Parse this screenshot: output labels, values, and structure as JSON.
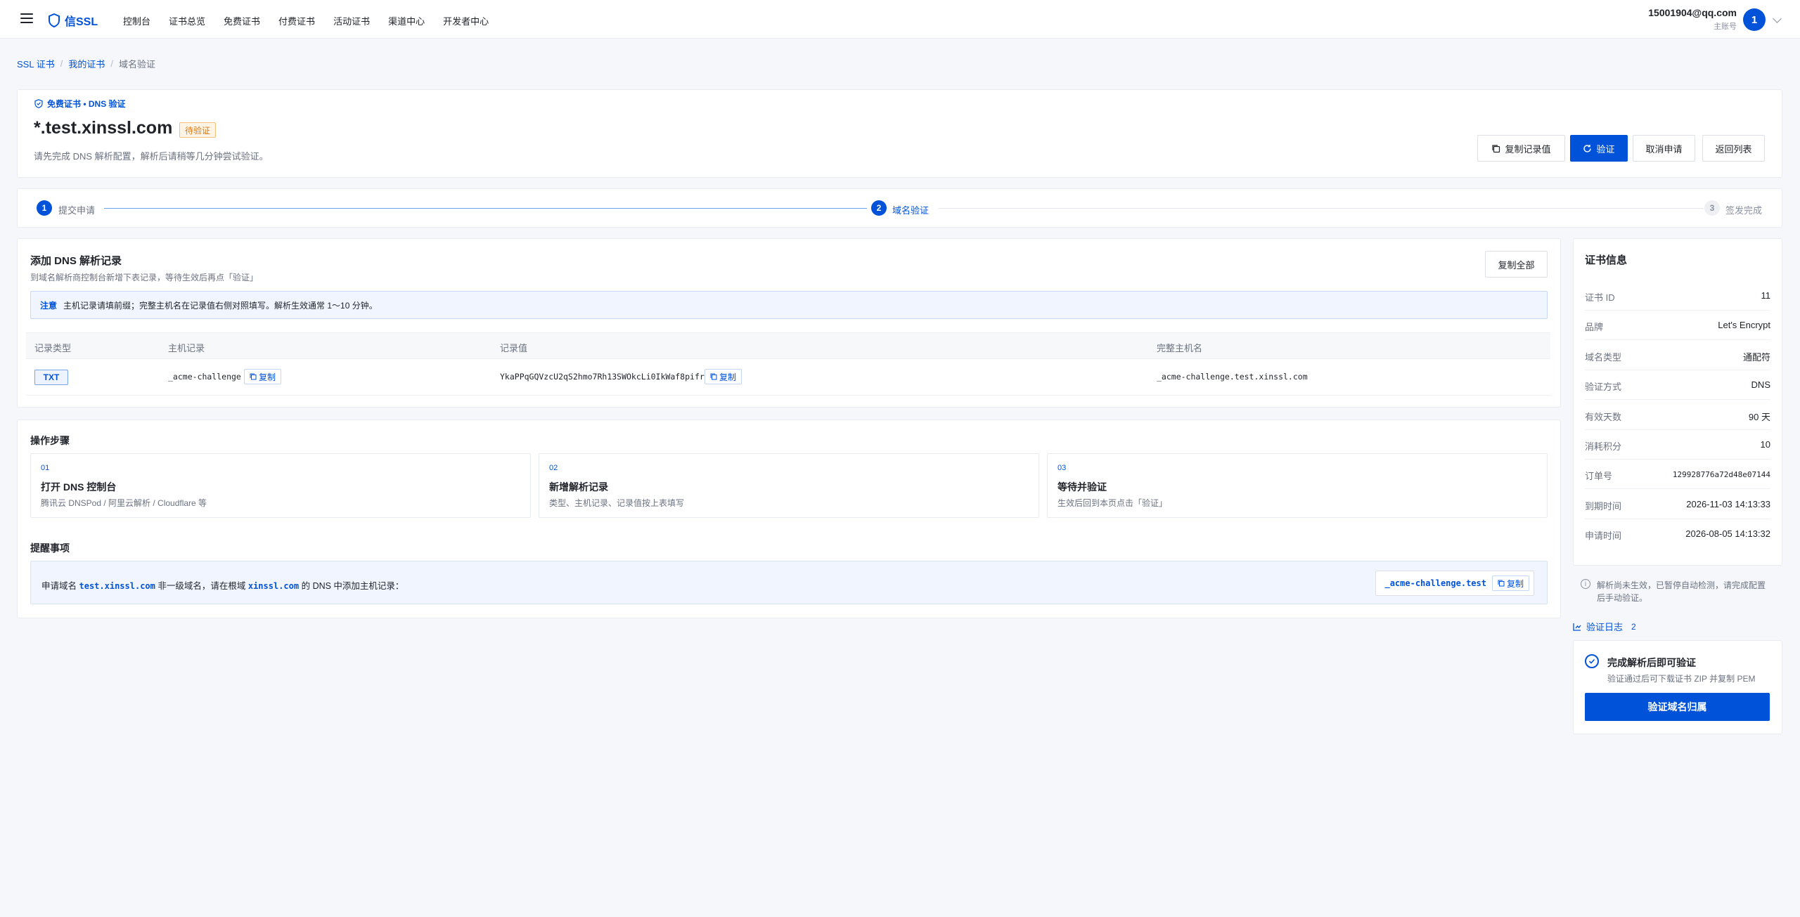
{
  "nav": {
    "brand": "信SSL",
    "items": [
      "控制台",
      "证书总览",
      "免费证书",
      "付费证书",
      "活动证书",
      "渠道中心",
      "开发者中心"
    ],
    "user_email": "15001904@qq.com",
    "user_role": "主账号",
    "avatar": "1"
  },
  "breadcrumb": {
    "items": [
      "SSL 证书",
      "我的证书"
    ],
    "current": "域名验证",
    "separator": "/"
  },
  "header": {
    "tag": "免费证书 • DNS 验证",
    "domain": "*.test.xinssl.com",
    "status": "待验证",
    "description": "请先完成 DNS 解析配置，解析后请稍等几分钟尝试验证。",
    "buttons": {
      "copy_record": "复制记录值",
      "verify": "验证",
      "cancel": "取消申请",
      "back": "返回列表"
    }
  },
  "steps": [
    {
      "num": "1",
      "label": "提交申请",
      "state": "done"
    },
    {
      "num": "2",
      "label": "域名验证",
      "state": "active"
    },
    {
      "num": "3",
      "label": "签发完成",
      "state": "pending"
    }
  ],
  "dns": {
    "title": "添加 DNS 解析记录",
    "subtitle": "到域名解析商控制台新增下表记录，等待生效后再点「验证」",
    "copy_all": "复制全部",
    "notice_label": "注意",
    "notice_text": "主机记录请填前缀；完整主机名在记录值右侧对照填写。解析生效通常 1～10 分钟。",
    "columns": [
      "记录类型",
      "主机记录",
      "记录值",
      "完整主机名"
    ],
    "row": {
      "type": "TXT",
      "host": "_acme-challenge",
      "value": "YkaPPqGQVzcU2qS2hmo7Rh13SWOkcLi0IkWaf8pifrI",
      "full": "_acme-challenge.test.xinssl.com",
      "copy": "复制"
    }
  },
  "ops": {
    "title": "操作步骤",
    "items": [
      {
        "num": "01",
        "title": "打开 DNS 控制台",
        "desc": "腾讯云 DNSPod / 阿里云解析 / Cloudflare 等"
      },
      {
        "num": "02",
        "title": "新增解析记录",
        "desc": "类型、主机记录、记录值按上表填写"
      },
      {
        "num": "03",
        "title": "等待并验证",
        "desc": "生效后回到本页点击「验证」"
      }
    ],
    "reminder_title": "提醒事项",
    "reminder": {
      "prefix": "申请域名",
      "domain": "test.xinssl.com",
      "middle": "非一级域名，请在根域",
      "root": "xinssl.com",
      "suffix": "的 DNS 中添加主机记录：",
      "host": "_acme-challenge.test",
      "copy": "复制"
    }
  },
  "cert_info": {
    "title": "证书信息",
    "rows": [
      {
        "key": "证书 ID",
        "value": "11"
      },
      {
        "key": "品牌",
        "value": "Let's Encrypt"
      },
      {
        "key": "域名类型",
        "value": "通配符"
      },
      {
        "key": "验证方式",
        "value": "DNS"
      },
      {
        "key": "有效天数",
        "value": "90 天"
      },
      {
        "key": "消耗积分",
        "value": "10"
      },
      {
        "key": "订单号",
        "value": "129928776a72d48e07144"
      },
      {
        "key": "到期时间",
        "value": "2026-11-03 14:13:33"
      },
      {
        "key": "申请时间",
        "value": "2026-08-05 14:13:32"
      }
    ],
    "hint": "解析尚未生效，已暂停自动检测，请完成配置后手动验证。",
    "log_label": "验证日志",
    "log_count": "2",
    "verify_title": "完成解析后即可验证",
    "verify_sub": "验证通过后可下载证书 ZIP 并复制 PEM",
    "verify_button": "验证域名归属"
  },
  "colors": {
    "accent": "#0052d9",
    "warning": "#d87a16",
    "background": "#f5f7fa"
  }
}
